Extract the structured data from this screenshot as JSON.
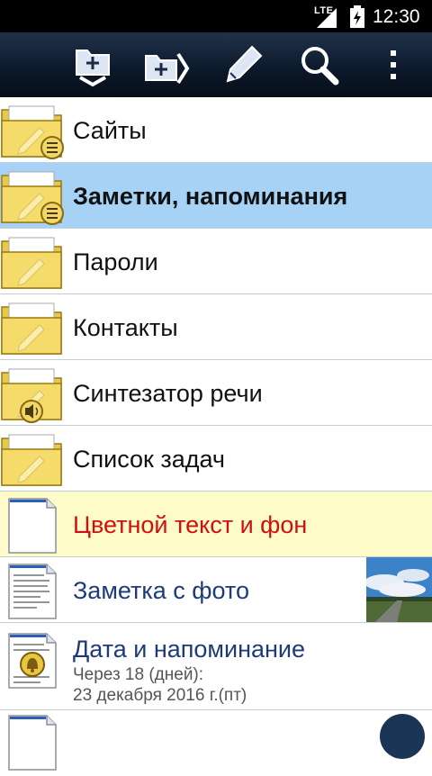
{
  "status_bar": {
    "network": "LTE",
    "time": "12:30"
  },
  "toolbar": {
    "icons": [
      "add-folder-icon",
      "move-to-folder-icon",
      "edit-icon",
      "search-icon",
      "overflow-menu-icon"
    ]
  },
  "items": [
    {
      "title": "Сайты",
      "type": "folder",
      "icon": "folder-list-icon"
    },
    {
      "title": "Заметки, напоминания",
      "type": "folder",
      "icon": "folder-list-icon",
      "selected": true
    },
    {
      "title": "Пароли",
      "type": "folder",
      "icon": "folder-icon"
    },
    {
      "title": "Контакты",
      "type": "folder",
      "icon": "folder-icon"
    },
    {
      "title": "Синтезатор речи",
      "type": "folder",
      "icon": "folder-speaker-icon"
    },
    {
      "title": "Список задач",
      "type": "folder",
      "icon": "folder-icon"
    },
    {
      "title": "Цветной текст и фон",
      "type": "note",
      "icon": "note-icon",
      "title_color": "#d01010",
      "background": "#fdfcc8"
    },
    {
      "title": "Заметка с фото",
      "type": "note",
      "icon": "note-text-icon",
      "title_color": "#1e3a7a"
    },
    {
      "title": "Дата и напоминание",
      "type": "note",
      "icon": "note-bell-icon",
      "title_color": "#1e3a7a",
      "subtitle_line1": "Через 18 (дней):",
      "subtitle_line2": "23 декабря 2016 г.(пт)"
    }
  ],
  "colors": {
    "selected_row": "#a6d3f5",
    "separator": "#c9ccd2",
    "toolbar": "#0d1a2c"
  }
}
